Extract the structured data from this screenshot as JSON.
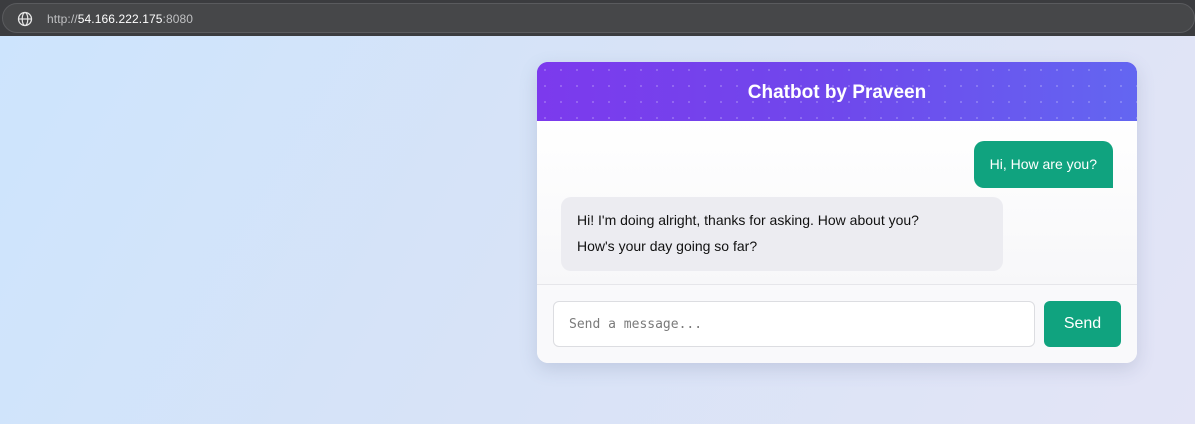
{
  "browser": {
    "url_scheme": "http://",
    "url_host": "54.166.222.175",
    "url_port": ":8080"
  },
  "chat": {
    "title": "Chatbot by Praveen",
    "messages": [
      {
        "role": "user",
        "text": "Hi, How are you?"
      },
      {
        "role": "bot",
        "line1": "Hi! I'm doing alright, thanks for asking. How about you?",
        "line2": "How's your day going so far?"
      }
    ],
    "input_placeholder": "Send a message...",
    "send_label": "Send"
  },
  "colors": {
    "header_start": "#7c3aed",
    "header_end": "#6366f1",
    "accent": "#10a37f",
    "bot_bubble": "#ececf1"
  }
}
